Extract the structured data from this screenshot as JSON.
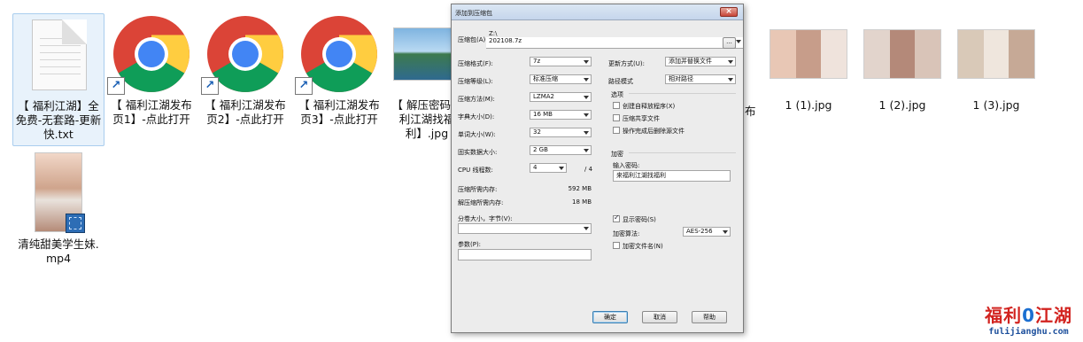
{
  "files": [
    {
      "name": "【 福利江湖】全免费-无套路-更新快.txt",
      "type": "txt"
    },
    {
      "name": "【 福利江湖发布页1】-点此打开",
      "type": "shortcut"
    },
    {
      "name": "【 福利江湖发布页2】-点此打开",
      "type": "shortcut"
    },
    {
      "name": "【 福利江湖发布页3】-点此打开",
      "type": "shortcut"
    },
    {
      "name": "【 解压密码福利江湖找福利】.jpg",
      "type": "image"
    },
    {
      "name": "1 (1).jpg",
      "type": "image"
    },
    {
      "name": "1 (2).jpg",
      "type": "image"
    },
    {
      "name": "1 (3).jpg",
      "type": "image"
    },
    {
      "name": "清纯甜美学生妹.mp4",
      "type": "video"
    }
  ],
  "hidden_label_fragment": "布",
  "dialog": {
    "title": "添加到压缩包",
    "close": "×",
    "archive_label": "压缩包(A)",
    "archive_path_hint": "Z:\\",
    "archive_name": "202108.7z",
    "browse": "...",
    "left": {
      "format_label": "压缩格式(F):",
      "format_value": "7z",
      "level_label": "压缩等级(L):",
      "level_value": "标准压缩",
      "method_label": "压缩方法(M):",
      "method_value": "LZMA2",
      "dict_label": "字典大小(D):",
      "dict_value": "16 MB",
      "word_label": "单词大小(W):",
      "word_value": "32",
      "solid_label": "固实数据大小:",
      "solid_value": "2 GB",
      "cpu_label": "CPU 线程数:",
      "cpu_value": "4",
      "cpu_total": "/ 4",
      "mem_comp_label": "压缩所需内存:",
      "mem_comp_value": "592 MB",
      "mem_decomp_label": "解压缩所需内存:",
      "mem_decomp_value": "18 MB",
      "split_label": "分卷大小，字节(V):",
      "params_label": "参数(P):"
    },
    "right": {
      "update_label": "更新方式(U):",
      "update_value": "添加并替换文件",
      "path_label": "路径模式",
      "path_value": "相对路径",
      "options_title": "选项",
      "opt_sfx": "创建自释放程序(X)",
      "opt_shared": "压缩共享文件",
      "opt_delete": "操作完成后删除源文件",
      "encrypt_title": "加密",
      "password_label": "输入密码:",
      "password_value": "来福利江湖找福利",
      "show_password": "显示密码(S)",
      "enc_method_label": "加密算法:",
      "enc_method_value": "AES-256",
      "enc_names": "加密文件名(N)"
    },
    "buttons": {
      "ok": "确定",
      "cancel": "取消",
      "help": "帮助"
    }
  },
  "watermark": {
    "cn_left": "福利",
    "cn_mid": "0",
    "cn_right": "江湖",
    "en": "fulijianghu.com"
  },
  "colors": {
    "selection": "#e8f2fb",
    "dialog_bg": "#ececec",
    "watermark_red": "#d2231f",
    "watermark_blue": "#1c6fd1"
  }
}
